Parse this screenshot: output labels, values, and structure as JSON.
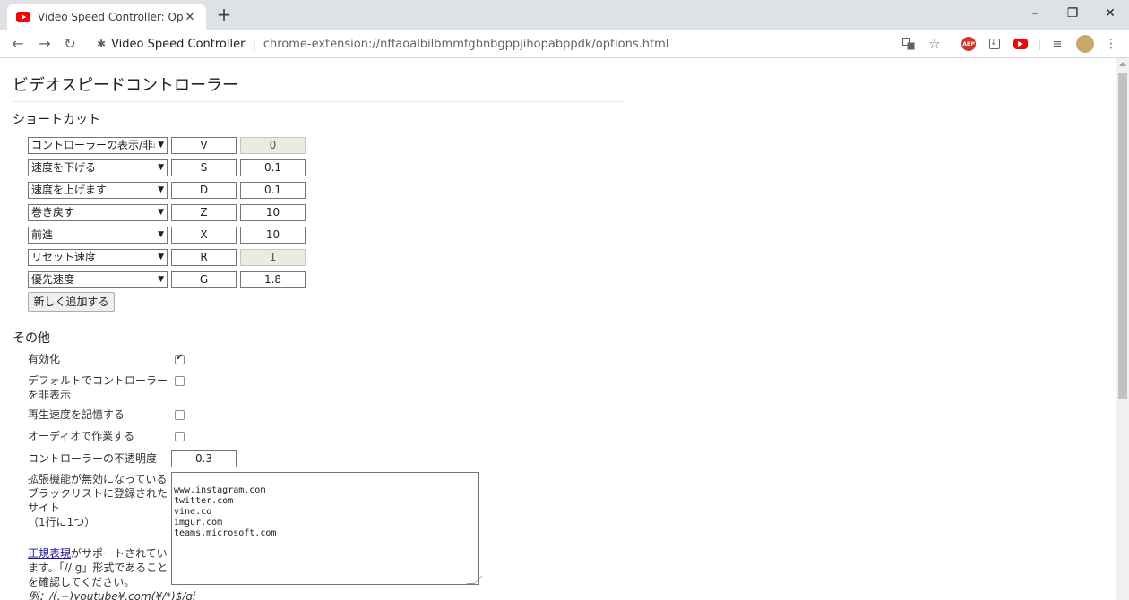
{
  "tab": {
    "title": "Video Speed Controller: Options",
    "close": "✕"
  },
  "newtab": "+",
  "window": {
    "minimize": "–",
    "restore": "❐",
    "close": "✕"
  },
  "nav": {
    "back": "←",
    "forward": "→",
    "reload": "↻"
  },
  "omnibox": {
    "site": "Video Speed Controller",
    "separator": "|",
    "url": "chrome-extension://nffaoalbilbmmfgbnbgppjihopabppdk/options.html"
  },
  "toolbar_icons": [
    "translate-icon",
    "star-icon",
    "adblock-plus-icon",
    "download-icon",
    "youtube-icon",
    "media-queue-icon",
    "avatar",
    "menu-icon"
  ],
  "page": {
    "title": "ビデオスピードコントローラー",
    "shortcuts_heading": "ショートカット",
    "shortcuts": [
      {
        "action": "コントローラーの表示/非表示",
        "key": "V",
        "value": "0",
        "disabled": true
      },
      {
        "action": "速度を下げる",
        "key": "S",
        "value": "0.1",
        "disabled": false
      },
      {
        "action": "速度を上げます",
        "key": "D",
        "value": "0.1",
        "disabled": false
      },
      {
        "action": "巻き戻す",
        "key": "Z",
        "value": "10",
        "disabled": false
      },
      {
        "action": "前進",
        "key": "X",
        "value": "10",
        "disabled": false
      },
      {
        "action": "リセット速度",
        "key": "R",
        "value": "1",
        "disabled": true
      },
      {
        "action": "優先速度",
        "key": "G",
        "value": "1.8",
        "disabled": false
      }
    ],
    "add_button": "新しく追加する",
    "other_heading": "その他",
    "options": {
      "enabled_label": "有効化",
      "hide_default_label": "デフォルトでコントローラーを非表示",
      "remember_speed_label": "再生速度を記憶する",
      "audio_label": "オーディオで作業する",
      "opacity_label": "コントローラーの不透明度",
      "opacity_value": "0.3",
      "blacklist_label": "拡張機能が無効になっているブラックリストに登録されたサイト",
      "blacklist_note": "（1行に1つ）",
      "regex_link": "正規表現",
      "regex_text": "がサポートされています。「// g」形式であることを確認してください。",
      "regex_example": "例：/(.+)youtube¥.com(¥/*)$/gi",
      "blacklist_sites": "www.instagram.com\ntwitter.com\nvine.co\nimgur.com\nteams.microsoft.com"
    },
    "checkbox_states": {
      "enabled": true,
      "hide_default": false,
      "remember_speed": false,
      "audio": false
    }
  }
}
